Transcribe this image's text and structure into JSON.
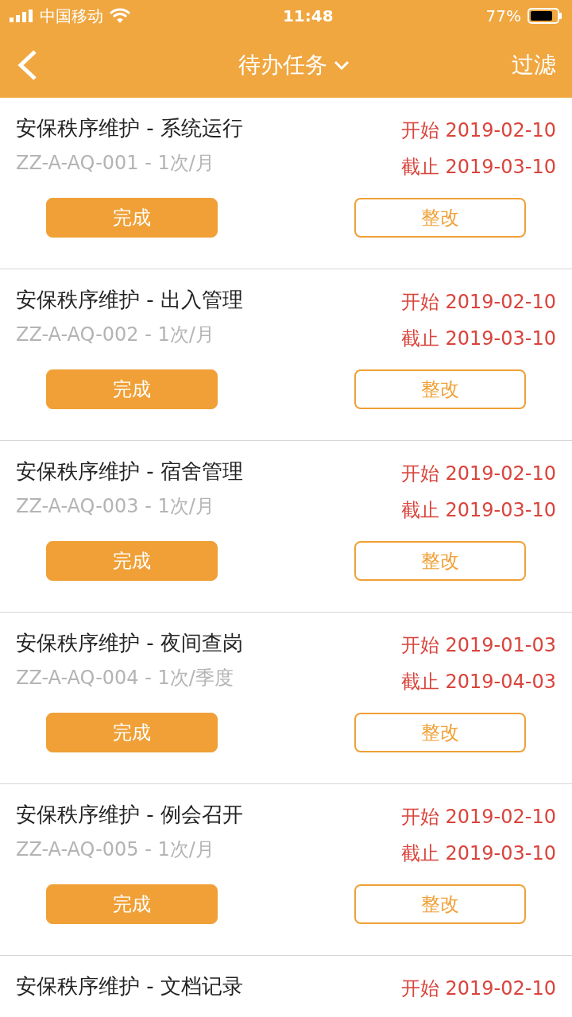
{
  "status_bar": {
    "carrier": "中国移动",
    "time": "11:48",
    "battery": "77%"
  },
  "nav": {
    "title": "待办任务",
    "action": "过滤"
  },
  "tasks": [
    {
      "title": "安保秩序维护 - 系统运行",
      "code": "ZZ-A-AQ-001 - 1次/月",
      "start": "开始 2019-02-10",
      "end": "截止 2019-03-10",
      "buttons": [
        "完成",
        "整改"
      ]
    },
    {
      "title": "安保秩序维护 - 出入管理",
      "code": "ZZ-A-AQ-002 - 1次/月",
      "start": "开始 2019-02-10",
      "end": "截止 2019-03-10",
      "buttons": [
        "完成",
        "整改"
      ]
    },
    {
      "title": "安保秩序维护 - 宿舍管理",
      "code": "ZZ-A-AQ-003 - 1次/月",
      "start": "开始 2019-02-10",
      "end": "截止 2019-03-10",
      "buttons": [
        "完成",
        "整改"
      ]
    },
    {
      "title": "安保秩序维护 - 夜间查岗",
      "code": "ZZ-A-AQ-004 - 1次/季度",
      "start": "开始 2019-01-03",
      "end": "截止 2019-04-03",
      "buttons": [
        "完成",
        "整改"
      ]
    },
    {
      "title": "安保秩序维护 - 例会召开",
      "code": "ZZ-A-AQ-005 - 1次/月",
      "start": "开始 2019-02-10",
      "end": "截止 2019-03-10",
      "buttons": [
        "完成",
        "整改"
      ]
    },
    {
      "title": "安保秩序维护 - 文档记录",
      "start": "开始 2019-02-10"
    }
  ]
}
